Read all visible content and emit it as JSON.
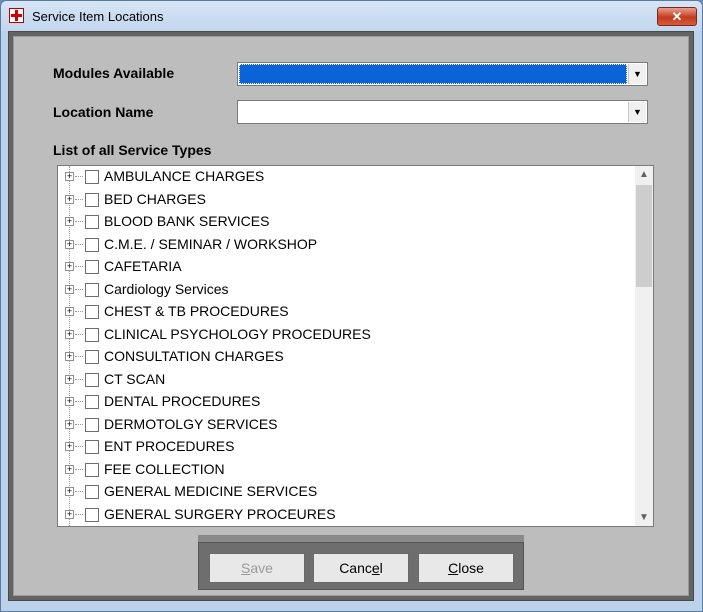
{
  "window": {
    "title": "Service Item Locations",
    "close_glyph": "✕"
  },
  "form": {
    "modules_label": "Modules Available",
    "modules_value": "",
    "location_label": "Location Name",
    "location_value": "",
    "list_label": "List of all Service Types"
  },
  "service_types": [
    "AMBULANCE CHARGES",
    "BED CHARGES",
    "BLOOD BANK SERVICES",
    "C.M.E. / SEMINAR / WORKSHOP",
    "CAFETARIA",
    "Cardiology Services",
    "CHEST & TB PROCEDURES",
    "CLINICAL PSYCHOLOGY PROCEDURES",
    "CONSULTATION CHARGES",
    "CT SCAN",
    "DENTAL PROCEDURES",
    "DERMOTOLGY SERVICES",
    "ENT PROCEDURES",
    "FEE COLLECTION",
    "GENERAL MEDICINE SERVICES",
    "GENERAL SURGERY PROCEURES"
  ],
  "buttons": {
    "save": {
      "pre": "",
      "accel": "S",
      "post": "ave"
    },
    "cancel": {
      "pre": "Canc",
      "accel": "e",
      "post": "l"
    },
    "close": {
      "pre": "",
      "accel": "C",
      "post": "lose"
    }
  },
  "colors": {
    "selection": "#0a64d8",
    "close_button": "#c43a1e"
  }
}
